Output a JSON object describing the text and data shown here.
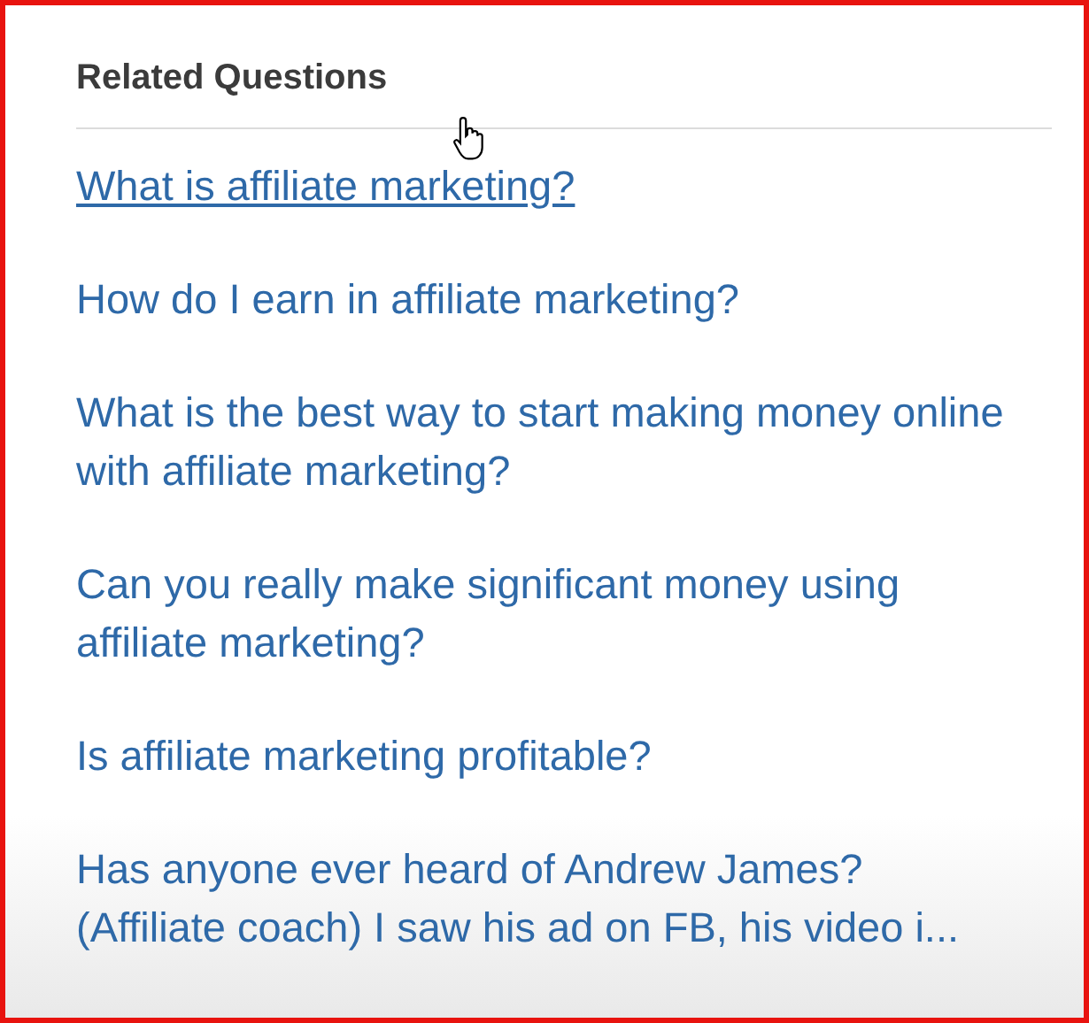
{
  "panel": {
    "title": "Related Questions"
  },
  "questions": [
    {
      "text": "What is affiliate marketing?",
      "hovered": true
    },
    {
      "text": "How do I earn in affiliate marketing?",
      "hovered": false
    },
    {
      "text": "What is the best way to start making money online with affiliate marketing?",
      "hovered": false
    },
    {
      "text": "Can you really make significant money using affiliate marketing?",
      "hovered": false
    },
    {
      "text": "Is affiliate marketing profitable?",
      "hovered": false
    },
    {
      "text": "Has anyone ever heard of Andrew James? (Affiliate coach) I saw his ad on FB, his video i...",
      "hovered": false
    }
  ]
}
